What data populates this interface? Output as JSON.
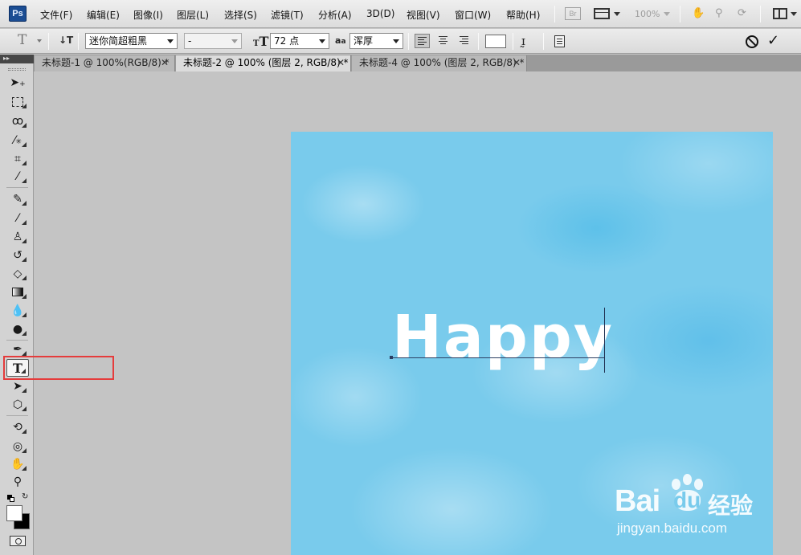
{
  "app": {
    "logo": "Ps"
  },
  "menu": [
    "文件(F)",
    "编辑(E)",
    "图像(I)",
    "图层(L)",
    "选择(S)",
    "滤镜(T)",
    "分析(A)",
    "3D(D)",
    "视图(V)",
    "窗口(W)",
    "帮助(H)"
  ],
  "menubar_right": {
    "bridge": "Br",
    "zoom": "100%"
  },
  "options": {
    "tool_glyph": "T",
    "font_family": "迷你简超粗黑",
    "font_style": "-",
    "font_size": "72 点",
    "antialias_label": "a",
    "antialias": "浑厚",
    "text_color": "#ffffff"
  },
  "tabs": [
    {
      "label": "未标题-1 @ 100%(RGB/8) *",
      "active": false
    },
    {
      "label": "未标题-2 @ 100% (图层 2, RGB/8) *",
      "active": true
    },
    {
      "label": "未标题-4 @ 100% (图层 2, RGB/8) *",
      "active": false
    }
  ],
  "tools": [
    "move",
    "marquee",
    "lasso",
    "magic-wand",
    "crop",
    "eyedropper",
    "healing",
    "brush",
    "clone-stamp",
    "history-brush",
    "eraser",
    "gradient",
    "blur",
    "dodge",
    "pen",
    "type",
    "path-selection",
    "shape",
    "3d-rotate",
    "3d-orbit",
    "hand",
    "zoom"
  ],
  "selected_tool": "type",
  "colors": {
    "foreground": "#ffffff",
    "background": "#000000",
    "canvas": "#79cbec",
    "highlight": "#e53c3c"
  },
  "canvas": {
    "text": "Happy"
  },
  "watermark": {
    "brand_prefix": "Bai",
    "brand_paw_letters": "du",
    "brand_cn": "经验",
    "url": "jingyan.baidu.com"
  }
}
